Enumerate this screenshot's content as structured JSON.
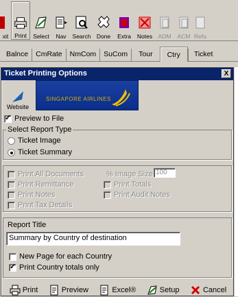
{
  "toolbar": {
    "buttons": [
      {
        "label": "xit"
      },
      {
        "label": "Print"
      },
      {
        "label": "Select"
      },
      {
        "label": "Nav"
      },
      {
        "label": "Search"
      },
      {
        "label": "Done"
      },
      {
        "label": "Extra"
      },
      {
        "label": "Notes"
      },
      {
        "label": "ADM"
      },
      {
        "label": "ACM"
      },
      {
        "label": "Refu"
      }
    ]
  },
  "tabs": [
    "Balnce",
    "CmRate",
    "NmCom",
    "SuCom",
    "Tour",
    "Ctry",
    "Ticket"
  ],
  "dialog": {
    "title": "Ticket Printing Options",
    "close_label": "X",
    "website_label": "Website",
    "banner_text": "SINGAPORE AIRLINES",
    "preview_to_file": "Preview to File",
    "report_type_group": "Select Report Type",
    "report_types": [
      "Ticket Image",
      "Ticket Summary"
    ],
    "options": {
      "print_all_documents": "Print All Documents",
      "image_size_label": "% Image Size",
      "image_size_value": "100",
      "print_remittance": "Print Remittance",
      "print_totals": "Print Totals",
      "print_notes": "Print Notes",
      "print_audit_notes": "Print Audit Notes",
      "print_tax_details": "Print Tax Details"
    },
    "report_title_label": "Report Title",
    "report_title_value": "Summary by Country of destination",
    "new_page_label": "New Page for each Country",
    "country_totals_label": "Print Country totals only",
    "buttons": {
      "print": "Print",
      "preview": "Preview",
      "excel": "Excel®",
      "setup": "Setup",
      "cancel": "Cancel"
    }
  }
}
